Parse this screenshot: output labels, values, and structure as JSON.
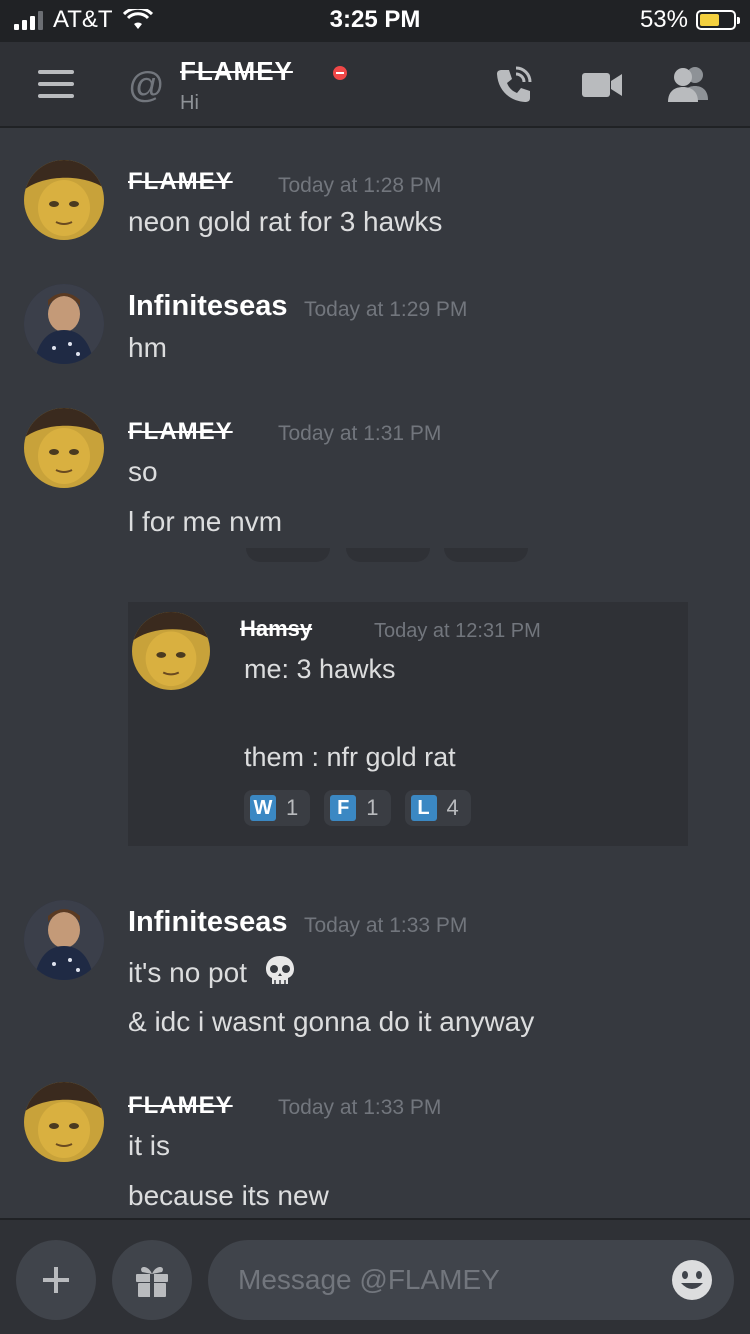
{
  "status_bar": {
    "carrier": "AT&T",
    "time": "3:25 PM",
    "battery_percent": "53%",
    "battery_level": 0.53
  },
  "header": {
    "at_symbol": "@",
    "recipient": "FLAMEY",
    "subtitle": "Hi",
    "icons": [
      "menu-icon",
      "voice-call-icon",
      "video-call-icon",
      "members-icon"
    ]
  },
  "messages": [
    {
      "author": "FLAMEY",
      "timestamp": "Today at 1:28 PM",
      "lines": [
        "neon gold rat for 3 hawks"
      ]
    },
    {
      "author": "Infiniteseas",
      "timestamp": "Today at 1:29 PM",
      "lines": [
        "hm"
      ]
    },
    {
      "author": "FLAMEY",
      "timestamp": "Today at 1:31 PM",
      "lines": [
        "so",
        "l for me nvm"
      ]
    },
    {
      "author": "Infiniteseas",
      "timestamp": "Today at 1:33 PM",
      "lines": [
        "it's no pot",
        "& idc i wasnt gonna do it anyway"
      ],
      "emoji": "skull"
    },
    {
      "author": "FLAMEY",
      "timestamp": "Today at 1:33 PM",
      "lines": [
        "it is",
        "because its new"
      ]
    }
  ],
  "embed": {
    "author": "Hamsy",
    "timestamp": "Today at 12:31 PM",
    "line1": "me: 3 hawks",
    "line2": "them : nfr gold rat",
    "reactions": [
      {
        "letter": "W",
        "count": "1"
      },
      {
        "letter": "F",
        "count": "1"
      },
      {
        "letter": "L",
        "count": "4"
      }
    ]
  },
  "composer": {
    "placeholder": "Message @FLAMEY",
    "icons": [
      "plus-icon",
      "gift-icon",
      "emoji-icon"
    ]
  }
}
